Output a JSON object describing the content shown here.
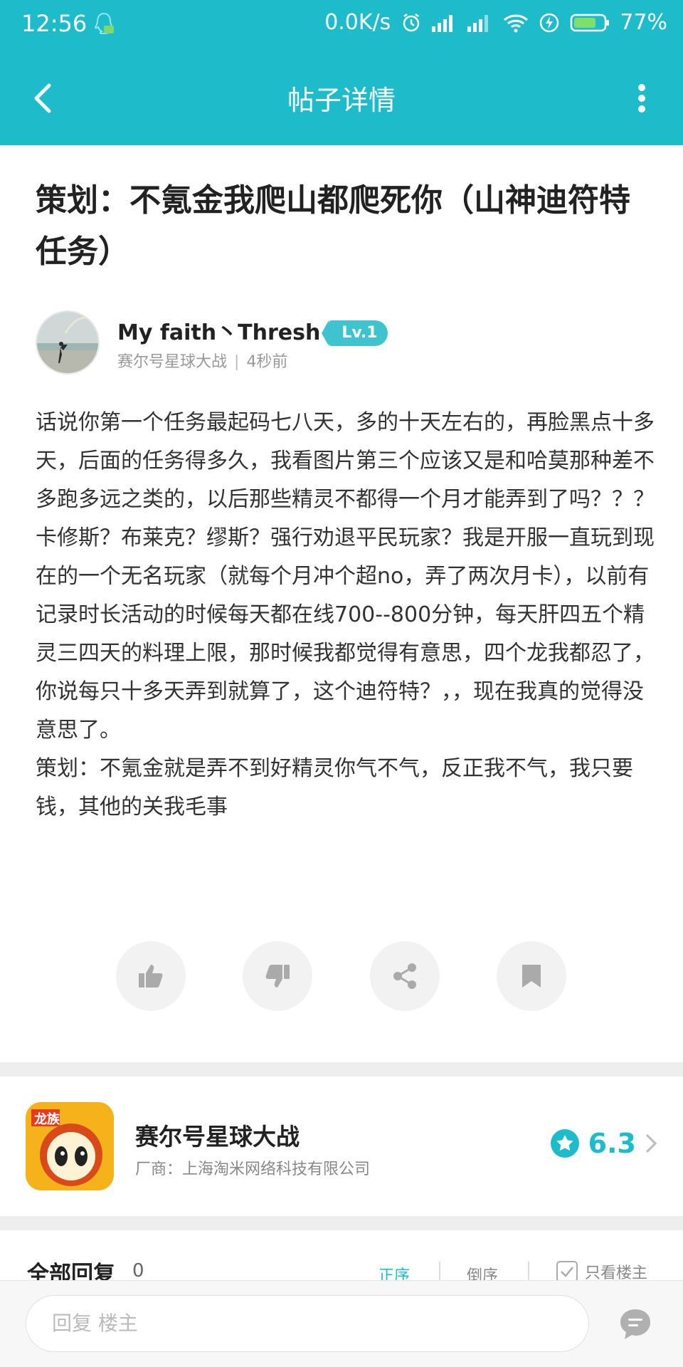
{
  "status_bar": {
    "time": "12:56",
    "net_speed": "0.0K/s",
    "battery": "77%"
  },
  "nav": {
    "title": "帖子详情"
  },
  "post": {
    "title": "策划：不氪金我爬山都爬死你（山神迪符特任务）",
    "author": {
      "name": "My faith丶Thresh",
      "level": "Lv.1",
      "board": "赛尔号星球大战",
      "time": "4秒前"
    },
    "body": "话说你第一个任务最起码七八天，多的十天左右的，再脸黑点十多天，后面的任务得多久，我看图片第三个应该又是和哈莫那种差不多跑多远之类的，以后那些精灵不都得一个月才能弄到了吗？？？卡修斯？布莱克？缪斯？强行劝退平民玩家？我是开服一直玩到现在的一个无名玩家（就每个月冲个超no，弄了两次月卡），以前有记录时长活动的时候每天都在线700--800分钟，每天肝四五个精灵三四天的料理上限，那时候我都觉得有意思，四个龙我都忍了，你说每只十多天弄到就算了，这个迪符特？，，现在我真的觉得没意思了。\n策划：不氪金就是弄不到好精灵你气不气，反正我不气，我只要钱，其他的关我毛事"
  },
  "actions": {
    "icons": [
      "thumbs-up-icon",
      "thumbs-down-icon",
      "share-icon",
      "bookmark-icon"
    ]
  },
  "game": {
    "name": "赛尔号星球大战",
    "developer": "厂商：上海淘米网络科技有限公司",
    "rating": "6.3"
  },
  "replies": {
    "label": "全部回复",
    "count": "0",
    "sort_asc": "正序",
    "sort_desc": "倒序",
    "only_op": "只看楼主"
  },
  "reply_bar": {
    "placeholder": "回复  楼主"
  },
  "colors": {
    "accent": "#1ebccb",
    "background": "#ffffff",
    "divider": "#eeeeee"
  }
}
